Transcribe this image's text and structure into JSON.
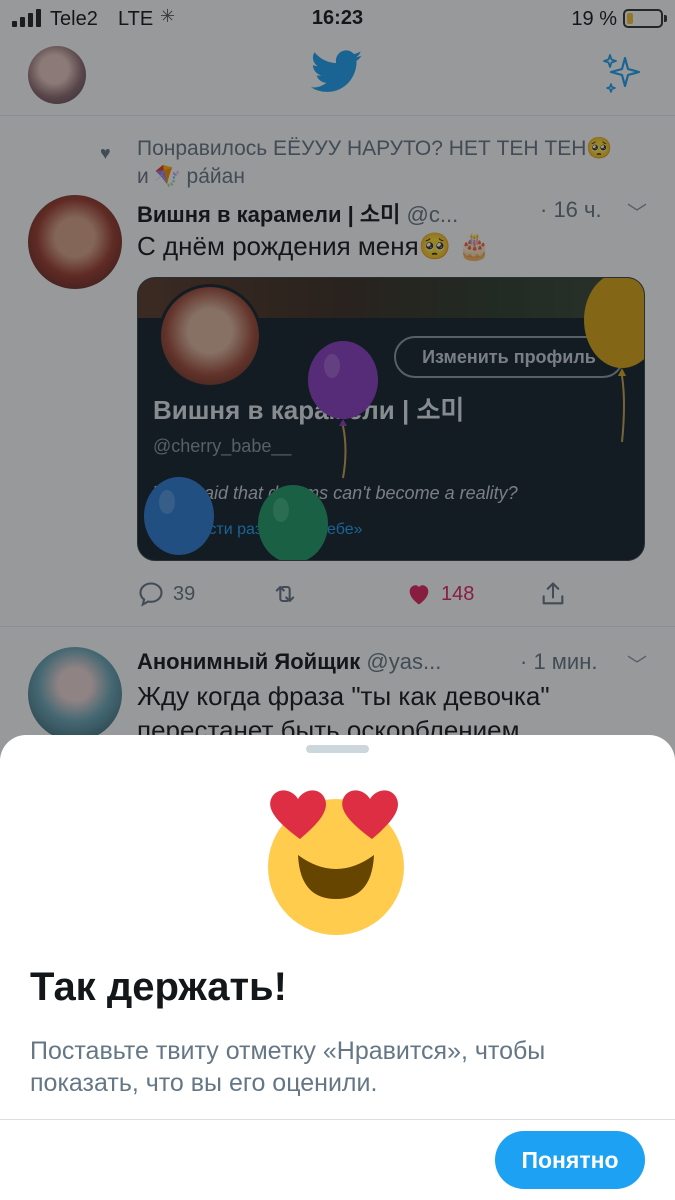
{
  "status_bar": {
    "carrier": "Tele2",
    "network": "LTE",
    "time": "16:23",
    "battery_text": "19 %",
    "battery_level": 0.19,
    "battery_color": "#f2c230"
  },
  "navbar": {
    "profile_icon": "avatar",
    "logo_icon": "twitter-bird-icon",
    "sparkle_icon": "sparkle-icon",
    "accent_color": "#1da1f2"
  },
  "tweet1": {
    "social_context": "Понравилось ЕЁУУУ НАРУТО? НЕТ ТЕН ТЕН🥺 и 🪁 ра́йан",
    "author_name": "Вишня в карамели | 소미",
    "handle": "@c...",
    "time": "· 16 ч.",
    "text": "С днём рождения меня🥺 🎂",
    "card": {
      "edit_button": "Изменить профиль",
      "name": "Вишня в карамели | 소미",
      "handle": "@cherry_babe__",
      "bio": "Who said that dreams can't become a reality?",
      "translate": "Перевести раздел «О себе»"
    },
    "replies": "39",
    "likes": "148",
    "like_color": "#e0245e"
  },
  "tweet2": {
    "author_name": "Анонимный Яойщик",
    "handle": "@yas...",
    "time": "· 1 мин.",
    "text": "Жду когда фраза \"ты как девочка\" перестанет быть оскорблением"
  },
  "sheet": {
    "emoji_icon": "heart-eyes-emoji",
    "title": "Так держать!",
    "description": "Поставьте твиту отметку «Нравится», чтобы показать, что вы его оценили.",
    "button_label": "Понятно",
    "button_color": "#1da1f2"
  }
}
